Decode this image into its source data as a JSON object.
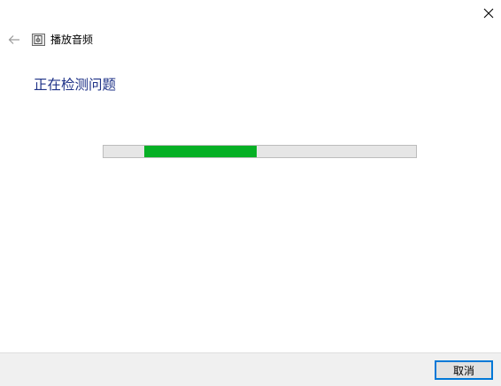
{
  "window": {
    "title": "播放音频",
    "close_icon": "close-icon",
    "back_icon": "back-arrow-icon",
    "app_icon": "speaker-troubleshooter-icon"
  },
  "main": {
    "heading": "正在检测问题",
    "heading_color": "#1e3287",
    "progress": {
      "type": "marquee",
      "shown_start_fraction": 0.13,
      "shown_end_fraction": 0.49,
      "color": "#06b025",
      "track_color": "#e6e6e6"
    }
  },
  "footer": {
    "cancel_label": "取消",
    "accent": "#0078d7"
  }
}
